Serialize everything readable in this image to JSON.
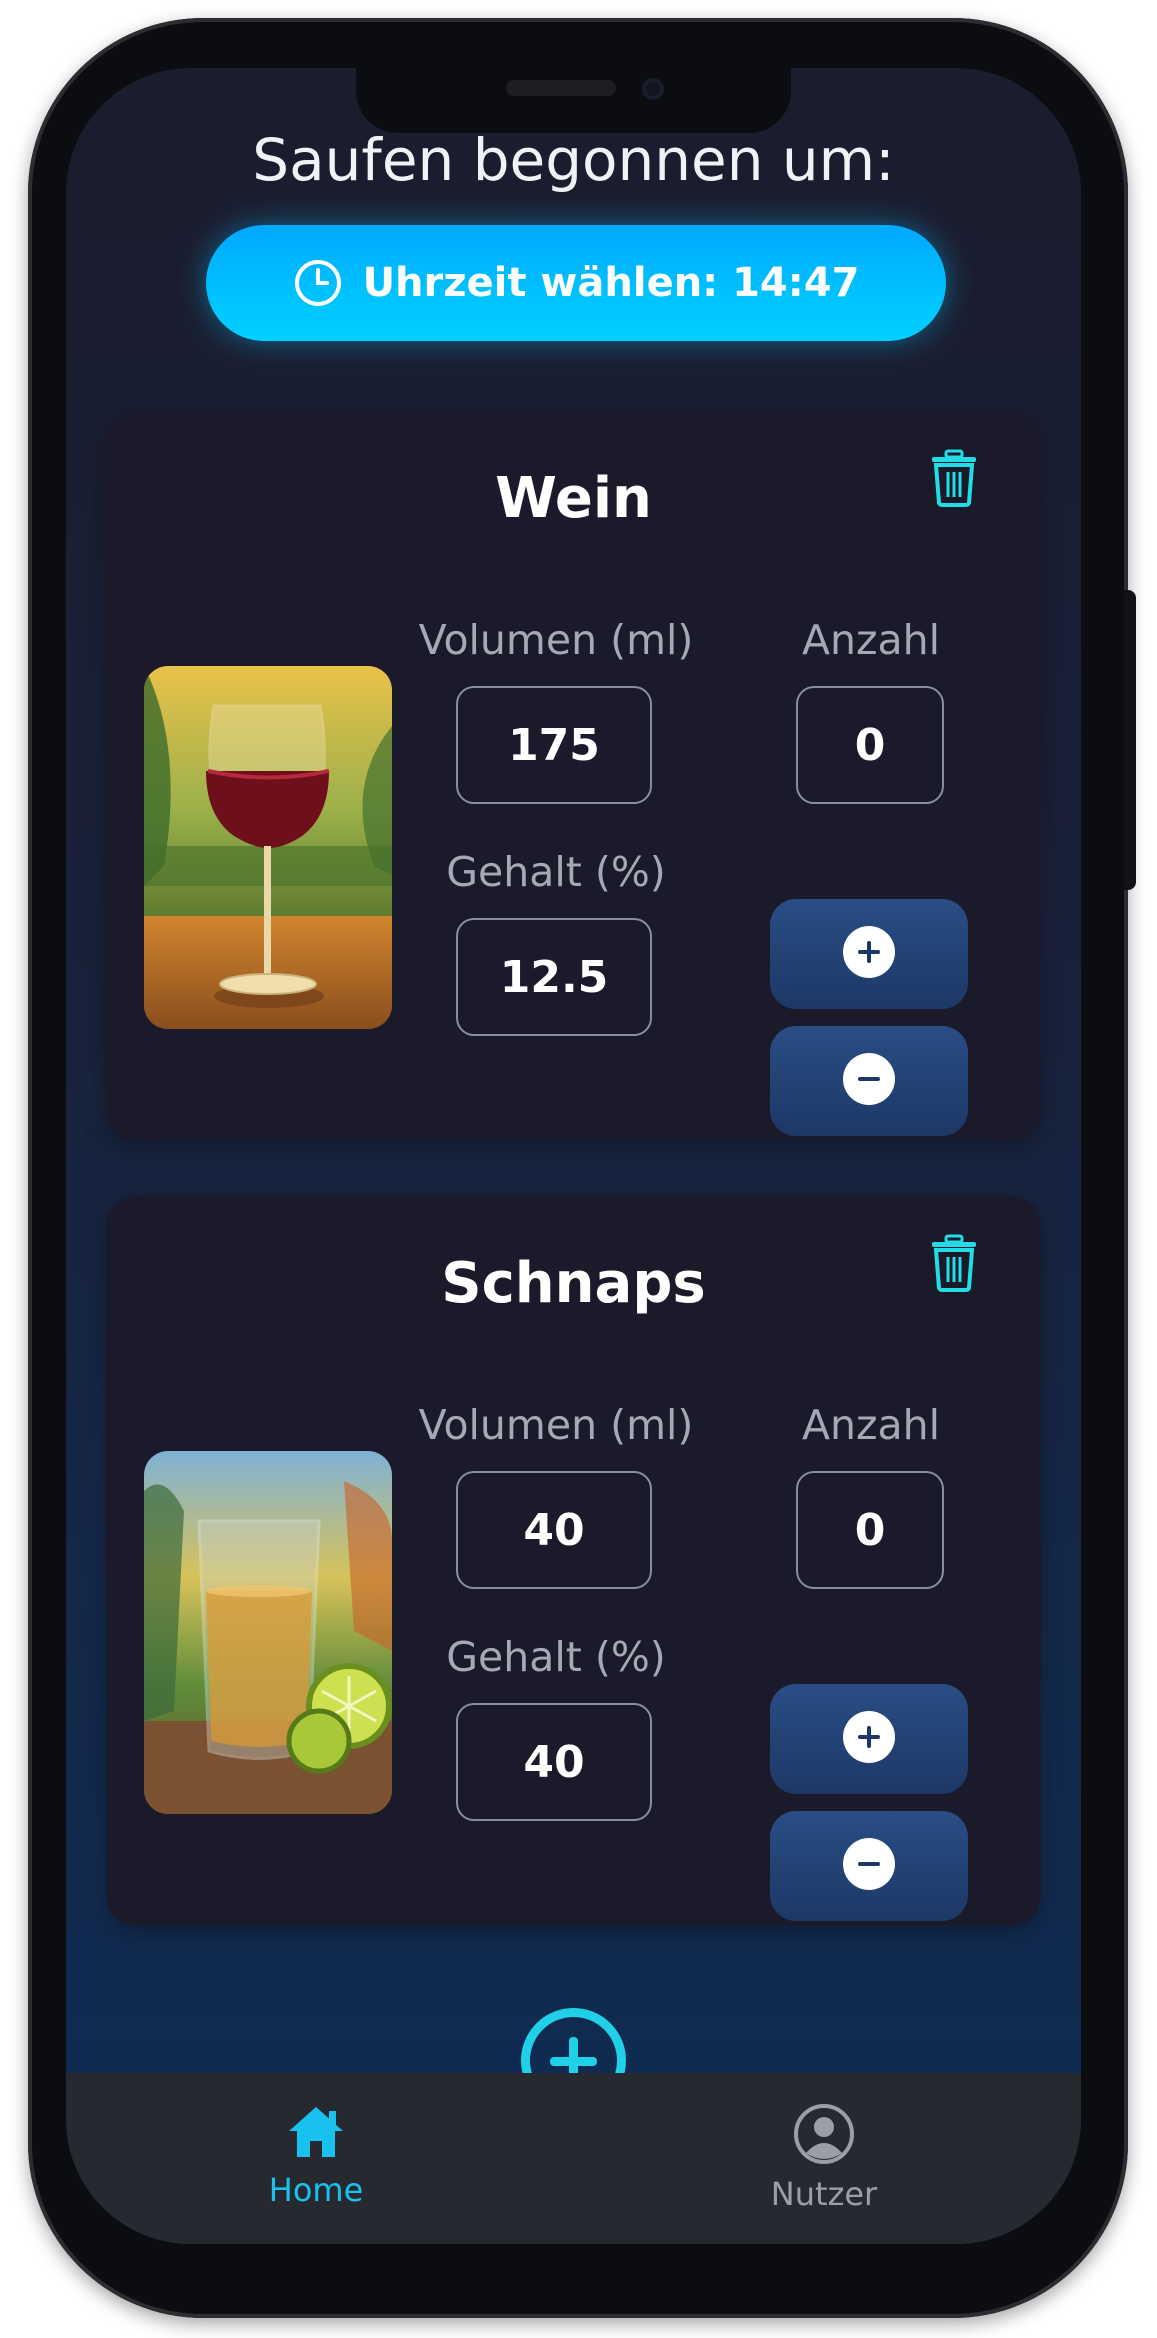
{
  "header": {
    "title": "Saufen begonnen um:",
    "time_button_label": "Uhrzeit wählen: 14:47"
  },
  "drinks": [
    {
      "name": "Wein",
      "volume_label": "Volumen (ml)",
      "volume": "175",
      "count_label": "Anzahl",
      "count": "0",
      "content_label": "Gehalt (%)",
      "content": "12.5",
      "image": "wine-glass-painting"
    },
    {
      "name": "Schnaps",
      "volume_label": "Volumen (ml)",
      "volume": "40",
      "count_label": "Anzahl",
      "count": "0",
      "content_label": "Gehalt (%)",
      "content": "40",
      "image": "shot-glass-with-lime-painting"
    }
  ],
  "icons": {
    "clock": "clock-icon",
    "trash": "trash-icon",
    "plus": "plus-icon",
    "minus": "minus-icon",
    "add": "add-circle-icon",
    "home": "home-icon",
    "user": "user-icon"
  },
  "tabs": [
    {
      "label": "Home",
      "active": true
    },
    {
      "label": "Nutzer",
      "active": false
    }
  ],
  "colors": {
    "accent": "#1fd0e8",
    "button_gradient_start": "#00a8ff",
    "card_bg": "#1a1a2b",
    "stepper_bg": "#1c3866"
  }
}
